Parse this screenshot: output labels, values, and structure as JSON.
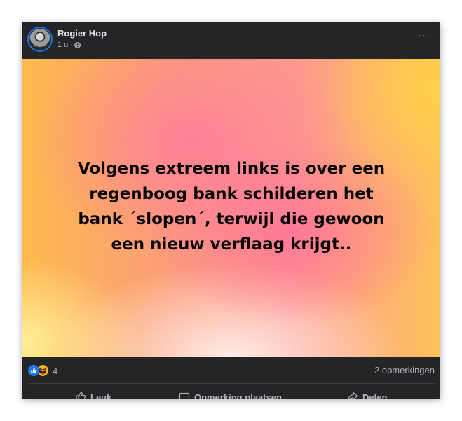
{
  "post": {
    "author": "Rogier Hop",
    "time": "1 u ·",
    "audience_icon": "globe-icon",
    "more_label": "···",
    "text": "Volgens extreem links is over een regenboog bank schilderen het bank ´slopen´, terwijl die gewoon een nieuw verflaag krijgt..",
    "background_colors": [
      "#fdba4d",
      "#fd7fa3",
      "#fff0eb",
      "#fdc35a"
    ]
  },
  "reactions": {
    "icons": [
      "like-icon",
      "haha-icon"
    ],
    "count": "4"
  },
  "comments": {
    "label": "2 opmerkingen"
  },
  "actions": {
    "like_label": "Leuk",
    "comment_label": "Opmerking plaatsen",
    "share_label": "Delen"
  },
  "colors": {
    "card_bg": "#242526",
    "like_blue": "#2078f4",
    "haha_yellow": "#f7b125",
    "secondary_text": "#b0b3b8"
  }
}
